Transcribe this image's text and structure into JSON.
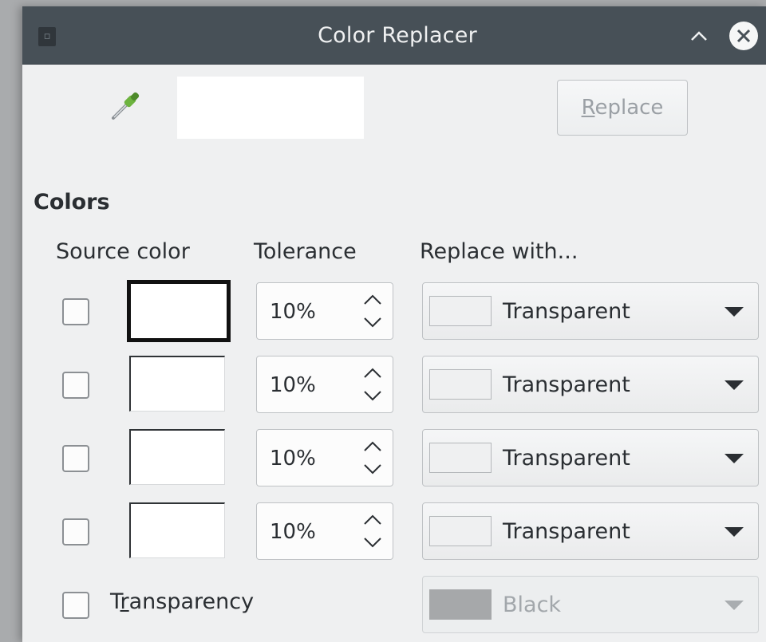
{
  "window": {
    "title": "Color Replacer",
    "icons": {
      "app": "document-app-icon",
      "minimize": "chevron-up-icon",
      "close": "close-icon"
    }
  },
  "toolbar": {
    "pipette_icon": "eyedropper-icon",
    "preview_color": "#ffffff",
    "replace_label_mnemonic": "R",
    "replace_label_rest": "eplace",
    "replace_enabled": false
  },
  "colors": {
    "section_title": "Colors",
    "headers": {
      "source": "Source color",
      "tolerance": "Tolerance",
      "replace": "Replace with..."
    },
    "rows": [
      {
        "checked": false,
        "source_color": "#ffffff",
        "tolerance": "10%",
        "replace_label": "Transparent"
      },
      {
        "checked": false,
        "source_color": "#ffffff",
        "tolerance": "10%",
        "replace_label": "Transparent"
      },
      {
        "checked": false,
        "source_color": "#ffffff",
        "tolerance": "10%",
        "replace_label": "Transparent"
      },
      {
        "checked": false,
        "source_color": "#ffffff",
        "tolerance": "10%",
        "replace_label": "Transparent"
      }
    ]
  },
  "transparency": {
    "label_prefix": "T",
    "label_mnemonic": "r",
    "label_rest": "ansparency",
    "checked": false,
    "replace_label": "Black",
    "replace_color": "#a6a8aa",
    "enabled": false
  }
}
